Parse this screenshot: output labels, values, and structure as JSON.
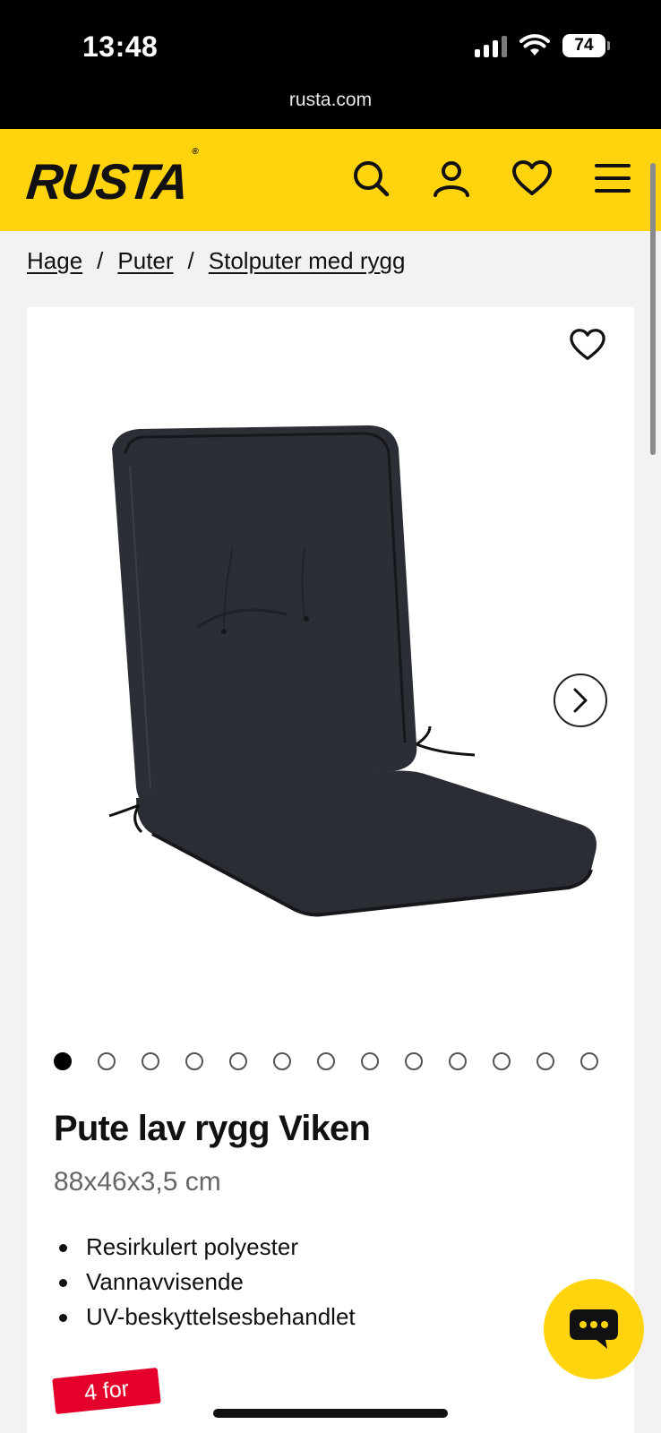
{
  "status_bar": {
    "time": "13:48",
    "battery": "74",
    "icons": [
      "cellular-signal-icon",
      "wifi-icon",
      "battery-icon"
    ]
  },
  "browser": {
    "url": "rusta.com"
  },
  "header": {
    "logo": "RUSTA",
    "logo_mark": "®",
    "background_color": "#ffd40f",
    "icons": [
      "search-icon",
      "account-icon",
      "wishlist-heart-icon",
      "menu-icon"
    ]
  },
  "breadcrumb": {
    "items": [
      "Hage",
      "Puter",
      "Stolputer med rygg"
    ],
    "separator": "/"
  },
  "product": {
    "title": "Pute lav rygg Viken",
    "dimensions": "88x46x3,5 cm",
    "features": [
      "Resirkulert polyester",
      "Vannavvisende",
      "UV-beskyttelsesbehandlet"
    ],
    "promo_badge": "4 for",
    "promo_color": "#e4002b",
    "gallery": {
      "image_count": 13,
      "active_index": 0
    }
  }
}
